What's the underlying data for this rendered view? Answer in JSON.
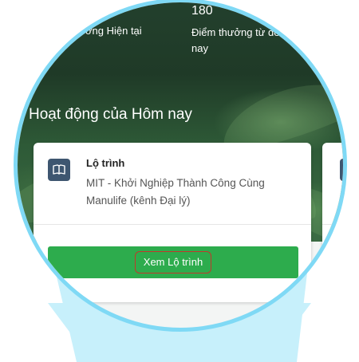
{
  "stats": {
    "value": "180",
    "left_label": "ơng Hiện tại",
    "right_label": "Điểm thưởng từ đến nay"
  },
  "section": {
    "title": "Hoạt động của Hôm nay"
  },
  "card": {
    "icon": "book-icon",
    "title": "Lộ trình",
    "description": "MIT - Khởi Nghiệp Thành Công Cùng Manulife (kênh Đại lý)",
    "button_label": "Xem Lộ trình"
  },
  "next_card": {
    "icon": "book-icon"
  },
  "colors": {
    "accent": "#2dac4d",
    "lens_border": "#7fd9f5",
    "beam": "#c7f0fb",
    "badge": "#3e5670",
    "highlight_border": "#c0392b"
  }
}
